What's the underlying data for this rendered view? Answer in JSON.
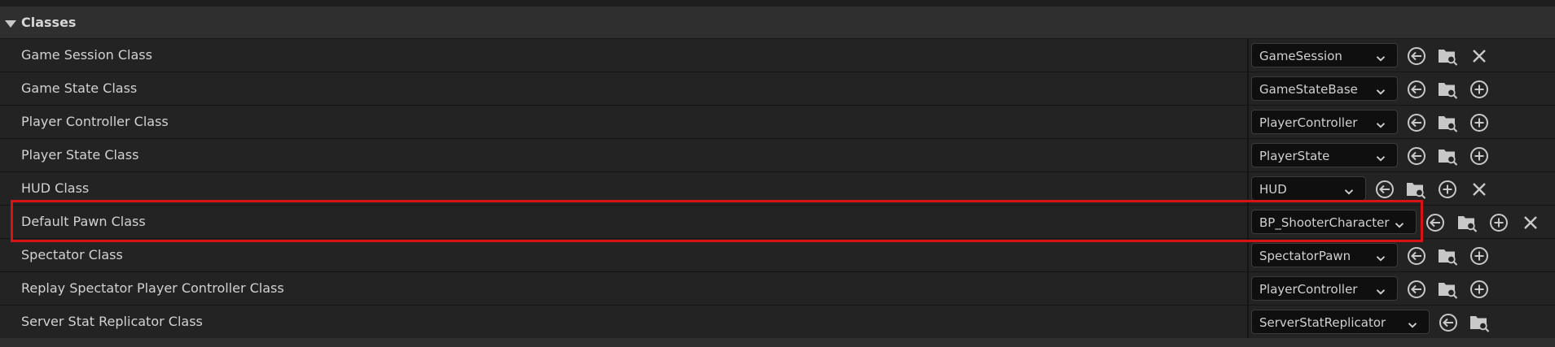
{
  "category": {
    "title": "Classes",
    "expand_icon": "triangle-down-icon"
  },
  "rows": [
    {
      "label": "Game Session Class",
      "value": "GameSession",
      "buttons": [
        "browse",
        "find",
        "clear"
      ]
    },
    {
      "label": "Game State Class",
      "value": "GameStateBase",
      "buttons": [
        "browse",
        "find",
        "add"
      ]
    },
    {
      "label": "Player Controller Class",
      "value": "PlayerController",
      "buttons": [
        "browse",
        "find",
        "add"
      ]
    },
    {
      "label": "Player State Class",
      "value": "PlayerState",
      "buttons": [
        "browse",
        "find",
        "add"
      ]
    },
    {
      "label": "HUD Class",
      "value": "HUD",
      "buttons": [
        "browse",
        "find",
        "add",
        "clear"
      ]
    },
    {
      "label": "Default Pawn Class",
      "value": "BP_ShooterCharacter",
      "buttons": [
        "browse",
        "find",
        "add",
        "clear"
      ]
    },
    {
      "label": "Spectator Class",
      "value": "SpectatorPawn",
      "buttons": [
        "browse",
        "find",
        "add"
      ]
    },
    {
      "label": "Replay Spectator Player Controller Class",
      "value": "PlayerController",
      "buttons": [
        "browse",
        "find",
        "add"
      ]
    },
    {
      "label": "Server Stat Replicator Class",
      "value": "ServerStatReplicator",
      "buttons": [
        "browse",
        "find"
      ]
    }
  ],
  "icons": {
    "browse": "use-selected-arrow-icon",
    "find": "browse-folder-icon",
    "add": "add-circle-icon",
    "clear": "clear-x-icon",
    "dropdown": "chevron-down-icon"
  },
  "colors": {
    "panel_bg": "#232323",
    "category_bg": "#2f2f2f",
    "combo_bg": "#0f0f0f",
    "text": "#d2d2d2",
    "highlight": "#d61414"
  },
  "highlighted_row": "Default Pawn Class"
}
